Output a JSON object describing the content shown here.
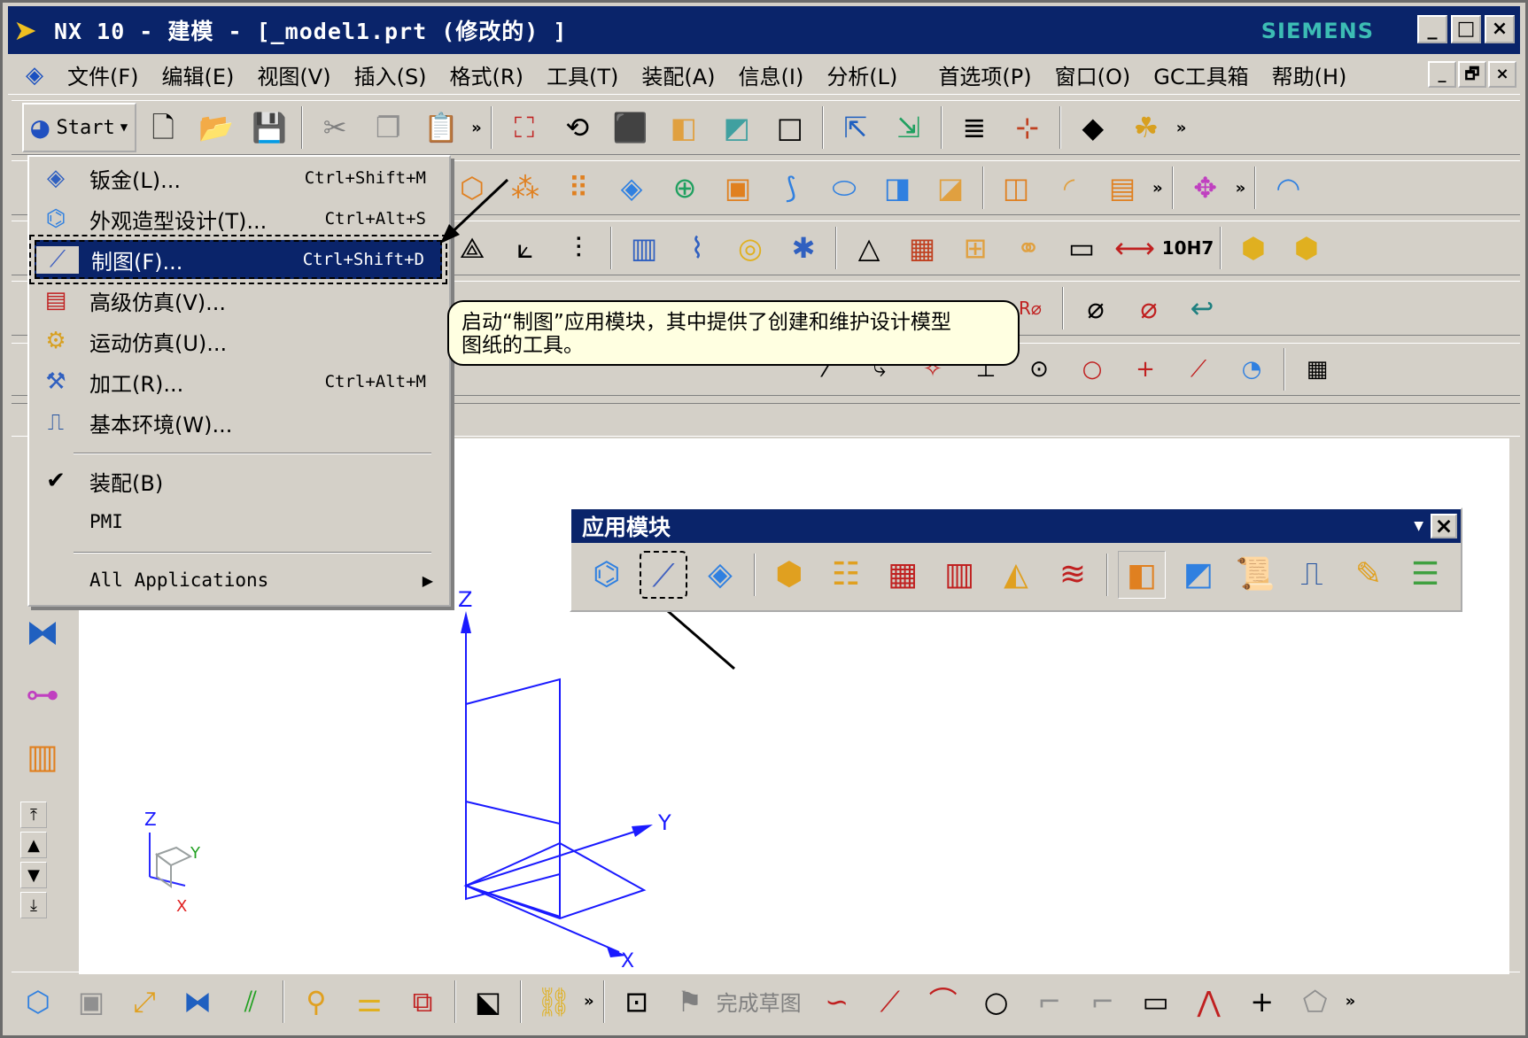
{
  "titlebar": {
    "title": "NX 10 - 建模 - [_model1.prt (修改的) ]",
    "brand": "SIEMENS",
    "controls": [
      "_",
      "□",
      "×"
    ]
  },
  "menubar": {
    "items": [
      "文件(F)",
      "编辑(E)",
      "视图(V)",
      "插入(S)",
      "格式(R)",
      "工具(T)",
      "装配(A)",
      "信息(I)",
      "分析(L)",
      "首选项(P)",
      "窗口(O)",
      "GC工具箱",
      "帮助(H)"
    ],
    "controls": [
      "_",
      "🗗",
      "×"
    ]
  },
  "toolbar": {
    "start_label": "Start",
    "overflow": "»"
  },
  "start_menu": {
    "items": [
      {
        "label": "钣金(L)...",
        "shortcut": "Ctrl+Shift+M",
        "icon": "sheet-metal-icon"
      },
      {
        "label": "外观造型设计(T)...",
        "shortcut": "Ctrl+Alt+S",
        "icon": "shape-studio-icon"
      },
      {
        "label": "制图(F)...",
        "shortcut": "Ctrl+Shift+D",
        "icon": "drafting-icon",
        "selected": true
      },
      {
        "label": "高级仿真(V)...",
        "shortcut": "",
        "icon": "advanced-simulation-icon"
      },
      {
        "label": "运动仿真(U)...",
        "shortcut": "",
        "icon": "motion-simulation-icon"
      },
      {
        "label": "加工(R)...",
        "shortcut": "Ctrl+Alt+M",
        "icon": "manufacturing-icon"
      },
      {
        "label": "基本环境(W)...",
        "shortcut": "",
        "icon": "gateway-icon"
      }
    ],
    "assembly_label": "装配(B)",
    "pmi_label": "PMI",
    "all_apps_label": "All Applications"
  },
  "tooltip": {
    "line1": "启动“制图”应用模块，其中提供了创建和维护设计模型",
    "line2": "图纸的工具。"
  },
  "palette": {
    "title": "应用模块",
    "close": "×"
  },
  "bottom_toolbar": {
    "finish_sketch": "完成草图"
  },
  "viewport": {
    "axis_x": "X",
    "axis_y": "Y",
    "axis_z": "Z"
  }
}
